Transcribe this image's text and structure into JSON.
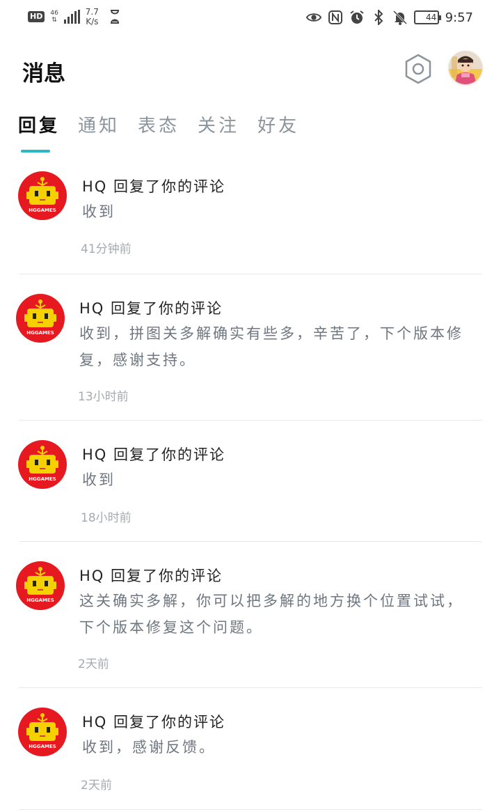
{
  "status_bar": {
    "hd": "HD",
    "network": "46",
    "speed_value": "7.7",
    "speed_unit": "K/s",
    "battery": "44",
    "time": "9:57"
  },
  "header": {
    "title": "消息",
    "settings_icon": "hexagon-gear-icon",
    "avatar_icon": "user-avatar"
  },
  "tabs": [
    {
      "label": "回复",
      "active": true
    },
    {
      "label": "通知",
      "active": false
    },
    {
      "label": "表态",
      "active": false
    },
    {
      "label": "关注",
      "active": false
    },
    {
      "label": "好友",
      "active": false
    }
  ],
  "messages": [
    {
      "title": "HQ 回复了你的评论",
      "body": "收到",
      "time": "41分钟前"
    },
    {
      "title": "HQ 回复了你的评论",
      "body": "收到，拼图关多解确实有些多，辛苦了，下个版本修复，感谢支持。",
      "time": "13小时前"
    },
    {
      "title": "HQ 回复了你的评论",
      "body": "收到",
      "time": "18小时前"
    },
    {
      "title": "HQ 回复了你的评论",
      "body": "这关确实多解，你可以把多解的地方换个位置试试，下个版本修复这个问题。",
      "time": "2天前"
    },
    {
      "title": "HQ 回复了你的评论",
      "body": "收到，感谢反馈。",
      "time": "2天前"
    }
  ],
  "logo_text": "HGGAMES",
  "colors": {
    "accent": "#2ab7c6",
    "avatar_red": "#e5191f",
    "robot_yellow": "#f5d100"
  }
}
